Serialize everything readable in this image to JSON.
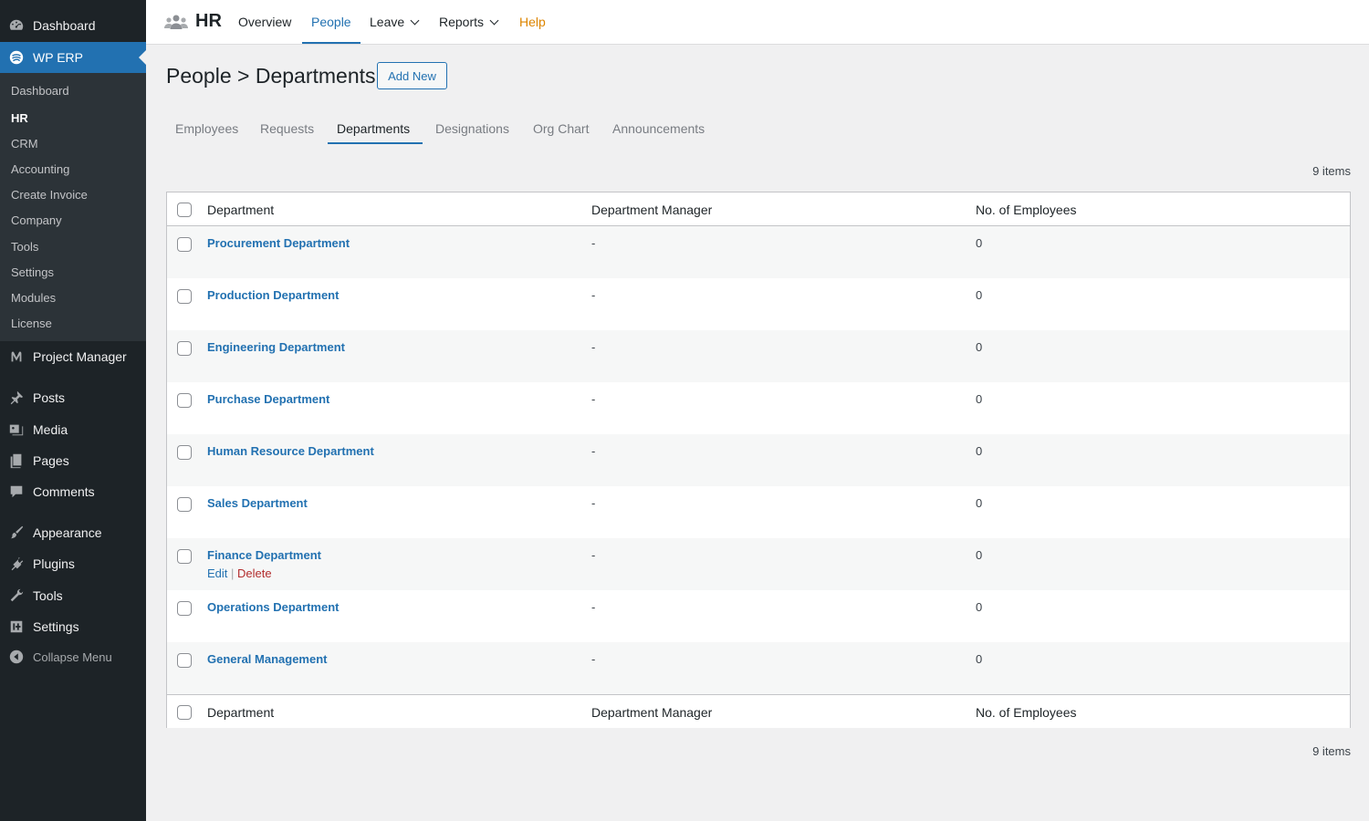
{
  "sidebar": {
    "dashboard": "Dashboard",
    "wp_erp": "WP ERP",
    "submenu": [
      "Dashboard",
      "HR",
      "CRM",
      "Accounting",
      "Create Invoice",
      "Company",
      "Tools",
      "Settings",
      "Modules",
      "License"
    ],
    "submenu_current": "HR",
    "project_manager": "Project Manager",
    "posts": "Posts",
    "media": "Media",
    "pages": "Pages",
    "comments": "Comments",
    "appearance": "Appearance",
    "plugins": "Plugins",
    "tools": "Tools",
    "settings": "Settings",
    "collapse": "Collapse Menu"
  },
  "topbar": {
    "title": "HR",
    "nav": {
      "overview": "Overview",
      "people": "People",
      "leave": "Leave",
      "reports": "Reports",
      "help": "Help"
    },
    "current": "People"
  },
  "page": {
    "title": "People > Departments",
    "add_new": "Add New"
  },
  "subtabs": [
    "Employees",
    "Requests",
    "Departments",
    "Designations",
    "Org Chart",
    "Announcements"
  ],
  "subtab_current": "Departments",
  "items_count": "9 items",
  "table": {
    "columns": {
      "department": "Department",
      "manager": "Department Manager",
      "employees": "No. of Employees"
    },
    "rows": [
      {
        "name": "Procurement Department",
        "manager": "-",
        "employees": "0"
      },
      {
        "name": "Production Department",
        "manager": "-",
        "employees": "0"
      },
      {
        "name": "Engineering Department",
        "manager": "-",
        "employees": "0"
      },
      {
        "name": "Purchase Department",
        "manager": "-",
        "employees": "0"
      },
      {
        "name": "Human Resource Department",
        "manager": "-",
        "employees": "0"
      },
      {
        "name": "Sales Department",
        "manager": "-",
        "employees": "0"
      },
      {
        "name": "Finance Department",
        "manager": "-",
        "employees": "0"
      },
      {
        "name": "Operations Department",
        "manager": "-",
        "employees": "0"
      },
      {
        "name": "General Management",
        "manager": "-",
        "employees": "0"
      }
    ],
    "row_actions": {
      "edit": "Edit",
      "separator": "|",
      "delete": "Delete"
    }
  },
  "colors": {
    "sidebar_bg": "#1d2327",
    "accent": "#2271b1",
    "help": "#dd8500",
    "delete": "#b32d2e"
  }
}
